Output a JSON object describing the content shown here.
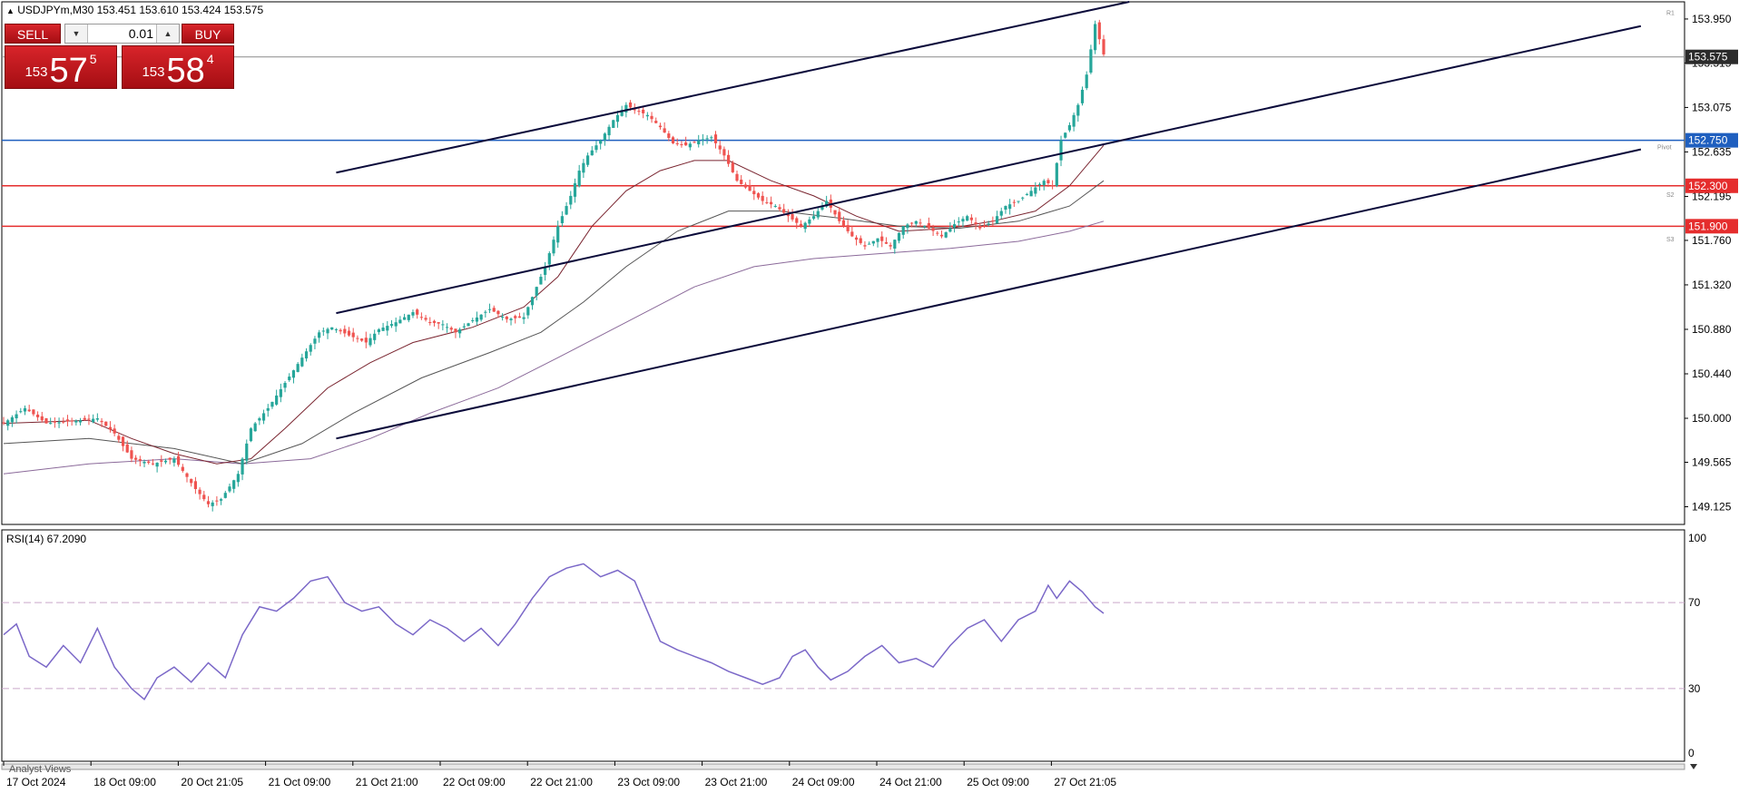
{
  "symbol_bar": {
    "marker": "▲",
    "text": "USDJPYm,M30  153.451 153.610 153.424 153.575"
  },
  "trade_panel": {
    "sell_label": "SELL",
    "buy_label": "BUY",
    "volume": "0.01",
    "bid": {
      "prefix": "153",
      "big": "57",
      "sup": "5"
    },
    "ask": {
      "prefix": "153",
      "big": "58",
      "sup": "4"
    }
  },
  "rsi_label": "RSI(14) 67.2090",
  "analyst_tab": "Analyst Views",
  "colors": {
    "bull": "#26a69a",
    "bear": "#ef5350",
    "hline_blue": "#1f5fbf",
    "hline_red": "#e52d2d",
    "channel": "#0a0a3a",
    "rsi": "#7b68c8",
    "bid_tag": "#2b2b2b"
  },
  "chart_data": [
    {
      "type": "candlestick",
      "symbol": "USDJPYm",
      "timeframe": "M30",
      "ylim": [
        148.95,
        154.12
      ],
      "y_ticks": [
        "153.950",
        "153.515",
        "153.075",
        "152.635",
        "152.195",
        "151.760",
        "151.320",
        "150.880",
        "150.440",
        "150.000",
        "149.565",
        "149.125"
      ],
      "x_ticks": [
        "17 Oct 2024",
        "18 Oct 09:00",
        "20 Oct 21:05",
        "21 Oct 09:00",
        "21 Oct 21:00",
        "22 Oct 09:00",
        "22 Oct 21:00",
        "23 Oct 09:00",
        "23 Oct 21:00",
        "24 Oct 09:00",
        "24 Oct 21:00",
        "25 Oct 09:00",
        "27 Oct 21:05"
      ],
      "x_range": [
        0,
        258
      ],
      "price_path": [
        [
          0,
          149.95
        ],
        [
          5,
          150.1
        ],
        [
          10,
          149.95
        ],
        [
          18,
          149.98
        ],
        [
          22,
          150.0
        ],
        [
          26,
          149.85
        ],
        [
          30,
          149.6
        ],
        [
          35,
          149.55
        ],
        [
          40,
          149.6
        ],
        [
          45,
          149.3
        ],
        [
          48,
          149.15
        ],
        [
          51,
          149.2
        ],
        [
          55,
          149.45
        ],
        [
          58,
          149.9
        ],
        [
          62,
          150.1
        ],
        [
          66,
          150.35
        ],
        [
          70,
          150.6
        ],
        [
          74,
          150.85
        ],
        [
          77,
          150.9
        ],
        [
          81,
          150.82
        ],
        [
          85,
          150.75
        ],
        [
          88,
          150.88
        ],
        [
          92,
          150.95
        ],
        [
          96,
          151.05
        ],
        [
          100,
          150.95
        ],
        [
          103,
          150.93
        ],
        [
          106,
          150.85
        ],
        [
          110,
          150.97
        ],
        [
          114,
          151.08
        ],
        [
          118,
          150.98
        ],
        [
          122,
          151.0
        ],
        [
          124,
          151.2
        ],
        [
          127,
          151.5
        ],
        [
          130,
          151.9
        ],
        [
          133,
          152.2
        ],
        [
          135,
          152.45
        ],
        [
          137,
          152.6
        ],
        [
          140,
          152.75
        ],
        [
          143,
          152.95
        ],
        [
          146,
          153.1
        ],
        [
          148,
          153.05
        ],
        [
          151,
          153.0
        ],
        [
          154,
          152.88
        ],
        [
          157,
          152.72
        ],
        [
          160,
          152.7
        ],
        [
          163,
          152.75
        ],
        [
          166,
          152.78
        ],
        [
          169,
          152.6
        ],
        [
          172,
          152.35
        ],
        [
          175,
          152.25
        ],
        [
          178,
          152.15
        ],
        [
          181,
          152.1
        ],
        [
          184,
          152.0
        ],
        [
          187,
          151.9
        ],
        [
          190,
          152.0
        ],
        [
          193,
          152.15
        ],
        [
          196,
          151.95
        ],
        [
          199,
          151.8
        ],
        [
          202,
          151.7
        ],
        [
          205,
          151.78
        ],
        [
          208,
          151.7
        ],
        [
          211,
          151.9
        ],
        [
          214,
          151.95
        ],
        [
          217,
          151.88
        ],
        [
          220,
          151.8
        ],
        [
          223,
          151.92
        ],
        [
          226,
          152.0
        ],
        [
          229,
          151.88
        ],
        [
          232,
          151.95
        ],
        [
          235,
          152.1
        ],
        [
          238,
          152.15
        ],
        [
          241,
          152.25
        ],
        [
          244,
          152.35
        ],
        [
          246,
          152.3
        ],
        [
          248,
          152.75
        ],
        [
          250,
          152.9
        ],
        [
          252,
          153.1
        ],
        [
          254,
          153.4
        ],
        [
          256,
          153.9
        ],
        [
          258,
          153.6
        ]
      ],
      "ma_fast_path": [
        [
          0,
          149.95
        ],
        [
          20,
          149.98
        ],
        [
          30,
          149.8
        ],
        [
          40,
          149.65
        ],
        [
          50,
          149.55
        ],
        [
          58,
          149.6
        ],
        [
          66,
          149.9
        ],
        [
          76,
          150.3
        ],
        [
          86,
          150.55
        ],
        [
          96,
          150.75
        ],
        [
          110,
          150.9
        ],
        [
          122,
          151.1
        ],
        [
          130,
          151.4
        ],
        [
          138,
          151.9
        ],
        [
          146,
          152.25
        ],
        [
          154,
          152.45
        ],
        [
          162,
          152.55
        ],
        [
          170,
          152.55
        ],
        [
          180,
          152.35
        ],
        [
          190,
          152.2
        ],
        [
          200,
          152.0
        ],
        [
          210,
          151.85
        ],
        [
          222,
          151.88
        ],
        [
          232,
          151.95
        ],
        [
          242,
          152.05
        ],
        [
          250,
          152.3
        ],
        [
          258,
          152.7
        ]
      ],
      "ma_mid_path": [
        [
          0,
          149.75
        ],
        [
          20,
          149.8
        ],
        [
          40,
          149.7
        ],
        [
          56,
          149.55
        ],
        [
          70,
          149.75
        ],
        [
          82,
          150.05
        ],
        [
          98,
          150.4
        ],
        [
          114,
          150.65
        ],
        [
          126,
          150.85
        ],
        [
          136,
          151.15
        ],
        [
          146,
          151.5
        ],
        [
          158,
          151.85
        ],
        [
          170,
          152.05
        ],
        [
          182,
          152.05
        ],
        [
          196,
          151.98
        ],
        [
          210,
          151.9
        ],
        [
          224,
          151.88
        ],
        [
          238,
          151.95
        ],
        [
          250,
          152.1
        ],
        [
          258,
          152.35
        ]
      ],
      "ma_slow_path": [
        [
          0,
          149.45
        ],
        [
          20,
          149.55
        ],
        [
          40,
          149.6
        ],
        [
          56,
          149.55
        ],
        [
          72,
          149.6
        ],
        [
          86,
          149.8
        ],
        [
          100,
          150.05
        ],
        [
          116,
          150.3
        ],
        [
          130,
          150.6
        ],
        [
          146,
          150.95
        ],
        [
          162,
          151.3
        ],
        [
          176,
          151.5
        ],
        [
          190,
          151.58
        ],
        [
          206,
          151.63
        ],
        [
          222,
          151.68
        ],
        [
          238,
          151.75
        ],
        [
          250,
          151.85
        ],
        [
          258,
          151.95
        ]
      ],
      "channel_lines": [
        {
          "from": [
            78,
            152.43
          ],
          "to": [
            264,
            154.12
          ]
        },
        {
          "from": [
            78,
            151.04
          ],
          "to": [
            384,
            153.88
          ]
        },
        {
          "from": [
            78,
            149.8
          ],
          "to": [
            384,
            152.66
          ]
        }
      ],
      "hlines": [
        {
          "value": 153.575,
          "label": "153.575",
          "style": "bid"
        },
        {
          "value": 152.75,
          "label": "152.750",
          "style": "blue"
        },
        {
          "value": 152.3,
          "label": "152.300",
          "style": "red"
        },
        {
          "value": 151.9,
          "label": "151.900",
          "style": "red"
        }
      ],
      "pivot_labels": [
        "R1",
        "Pivot",
        "S2",
        "S3"
      ]
    },
    {
      "type": "line",
      "name": "RSI(14)",
      "ylim": [
        0,
        100
      ],
      "y_ticks": [
        "100",
        "70",
        "30",
        "0"
      ],
      "levels": [
        70,
        30
      ],
      "x_range": [
        0,
        258
      ],
      "values_path": [
        [
          0,
          55
        ],
        [
          3,
          60
        ],
        [
          6,
          45
        ],
        [
          10,
          40
        ],
        [
          14,
          50
        ],
        [
          18,
          42
        ],
        [
          22,
          58
        ],
        [
          26,
          40
        ],
        [
          30,
          30
        ],
        [
          33,
          25
        ],
        [
          36,
          35
        ],
        [
          40,
          40
        ],
        [
          44,
          33
        ],
        [
          48,
          42
        ],
        [
          52,
          35
        ],
        [
          56,
          55
        ],
        [
          60,
          68
        ],
        [
          64,
          66
        ],
        [
          68,
          72
        ],
        [
          72,
          80
        ],
        [
          76,
          82
        ],
        [
          80,
          70
        ],
        [
          84,
          66
        ],
        [
          88,
          68
        ],
        [
          92,
          60
        ],
        [
          96,
          55
        ],
        [
          100,
          62
        ],
        [
          104,
          58
        ],
        [
          108,
          52
        ],
        [
          112,
          58
        ],
        [
          116,
          50
        ],
        [
          120,
          60
        ],
        [
          124,
          72
        ],
        [
          128,
          82
        ],
        [
          132,
          86
        ],
        [
          136,
          88
        ],
        [
          140,
          82
        ],
        [
          144,
          85
        ],
        [
          148,
          80
        ],
        [
          151,
          66
        ],
        [
          154,
          52
        ],
        [
          158,
          48
        ],
        [
          162,
          45
        ],
        [
          166,
          42
        ],
        [
          170,
          38
        ],
        [
          174,
          35
        ],
        [
          178,
          32
        ],
        [
          182,
          35
        ],
        [
          185,
          45
        ],
        [
          188,
          48
        ],
        [
          191,
          40
        ],
        [
          194,
          34
        ],
        [
          198,
          38
        ],
        [
          202,
          45
        ],
        [
          206,
          50
        ],
        [
          210,
          42
        ],
        [
          214,
          44
        ],
        [
          218,
          40
        ],
        [
          222,
          50
        ],
        [
          226,
          58
        ],
        [
          230,
          62
        ],
        [
          234,
          52
        ],
        [
          238,
          62
        ],
        [
          242,
          66
        ],
        [
          245,
          78
        ],
        [
          247,
          72
        ],
        [
          250,
          80
        ],
        [
          253,
          75
        ],
        [
          256,
          68
        ],
        [
          258,
          65
        ]
      ]
    }
  ]
}
